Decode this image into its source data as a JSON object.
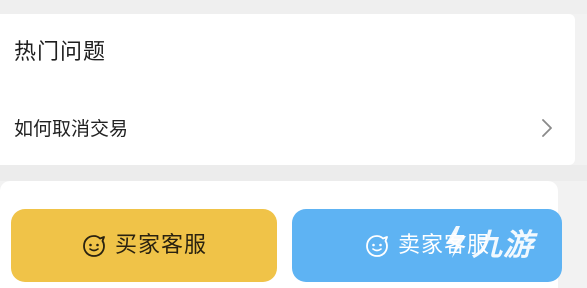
{
  "faq": {
    "title": "热门问题",
    "items": [
      {
        "label": "如何取消交易"
      }
    ]
  },
  "actions": {
    "buyer_service": "买家客服",
    "seller_service": "卖家客服"
  },
  "watermark": {
    "text": "九游"
  },
  "colors": {
    "buyer_button": "#f0c348",
    "seller_button": "#5eb3f3",
    "background": "#f2f2f2"
  },
  "icons": {
    "faq_item": "chevron-right-icon",
    "service": "smiley-chat-icon",
    "watermark": "jiuyou-logo-icon"
  }
}
